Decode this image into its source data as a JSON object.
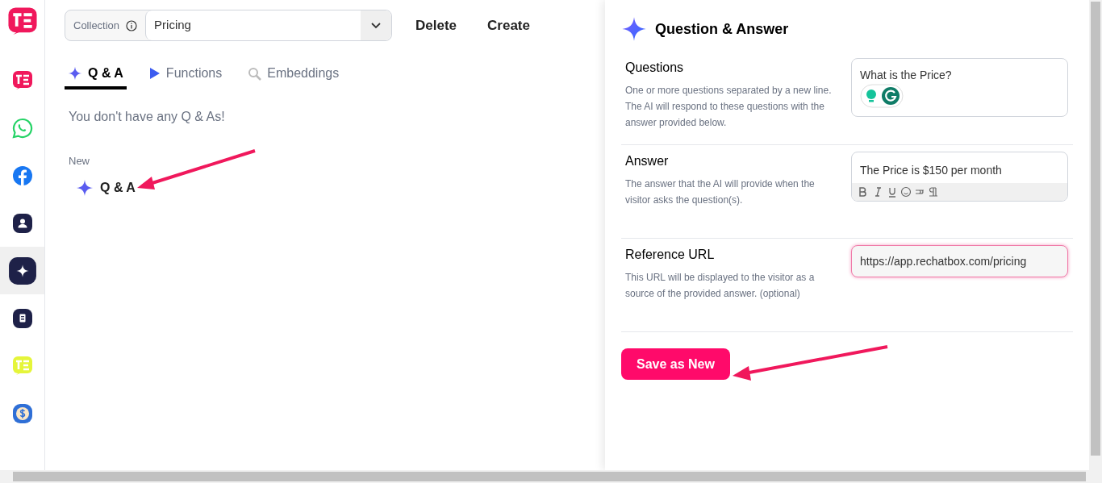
{
  "sidebar": {
    "items": [
      {
        "kind": "brand",
        "selected": false
      },
      {
        "kind": "whatsapp",
        "selected": false
      },
      {
        "kind": "facebook",
        "selected": false
      },
      {
        "kind": "contact",
        "selected": false
      },
      {
        "kind": "sparkle",
        "selected": true
      },
      {
        "kind": "document",
        "selected": false
      },
      {
        "kind": "brand-yellow",
        "selected": false
      },
      {
        "kind": "dollar",
        "selected": false
      }
    ]
  },
  "collection": {
    "label": "Collection",
    "value": "Pricing"
  },
  "actions": [
    "Delete",
    "Create"
  ],
  "tabs": [
    {
      "label": "Q & A",
      "kind": "sparkle",
      "selected": true
    },
    {
      "label": "Functions",
      "kind": "play",
      "selected": false
    },
    {
      "label": "Embeddings",
      "kind": "search",
      "selected": false
    }
  ],
  "empty_message": "You don't have any Q & As!",
  "new_section": {
    "title": "New",
    "items": [
      "Q & A"
    ]
  },
  "panel": {
    "title": "Question & Answer",
    "fields": [
      {
        "kind": "textarea",
        "label": "Questions",
        "help": "One or more questions separated by a new line. The AI will respond to these questions with the answer provided below.",
        "value": "What is the Price?",
        "focused": false
      },
      {
        "kind": "rich",
        "label": "Answer",
        "help": "The answer that the AI will provide when the visitor asks the question(s).",
        "value": "The Price is $150 per month",
        "focused": false
      },
      {
        "kind": "input",
        "label": "Reference URL",
        "help": "This URL will be displayed to the visitor as a source of the provided answer. (optional)",
        "value": "https://app.rechatbox.com/pricing",
        "focused": true
      }
    ],
    "button": "Save as New"
  }
}
